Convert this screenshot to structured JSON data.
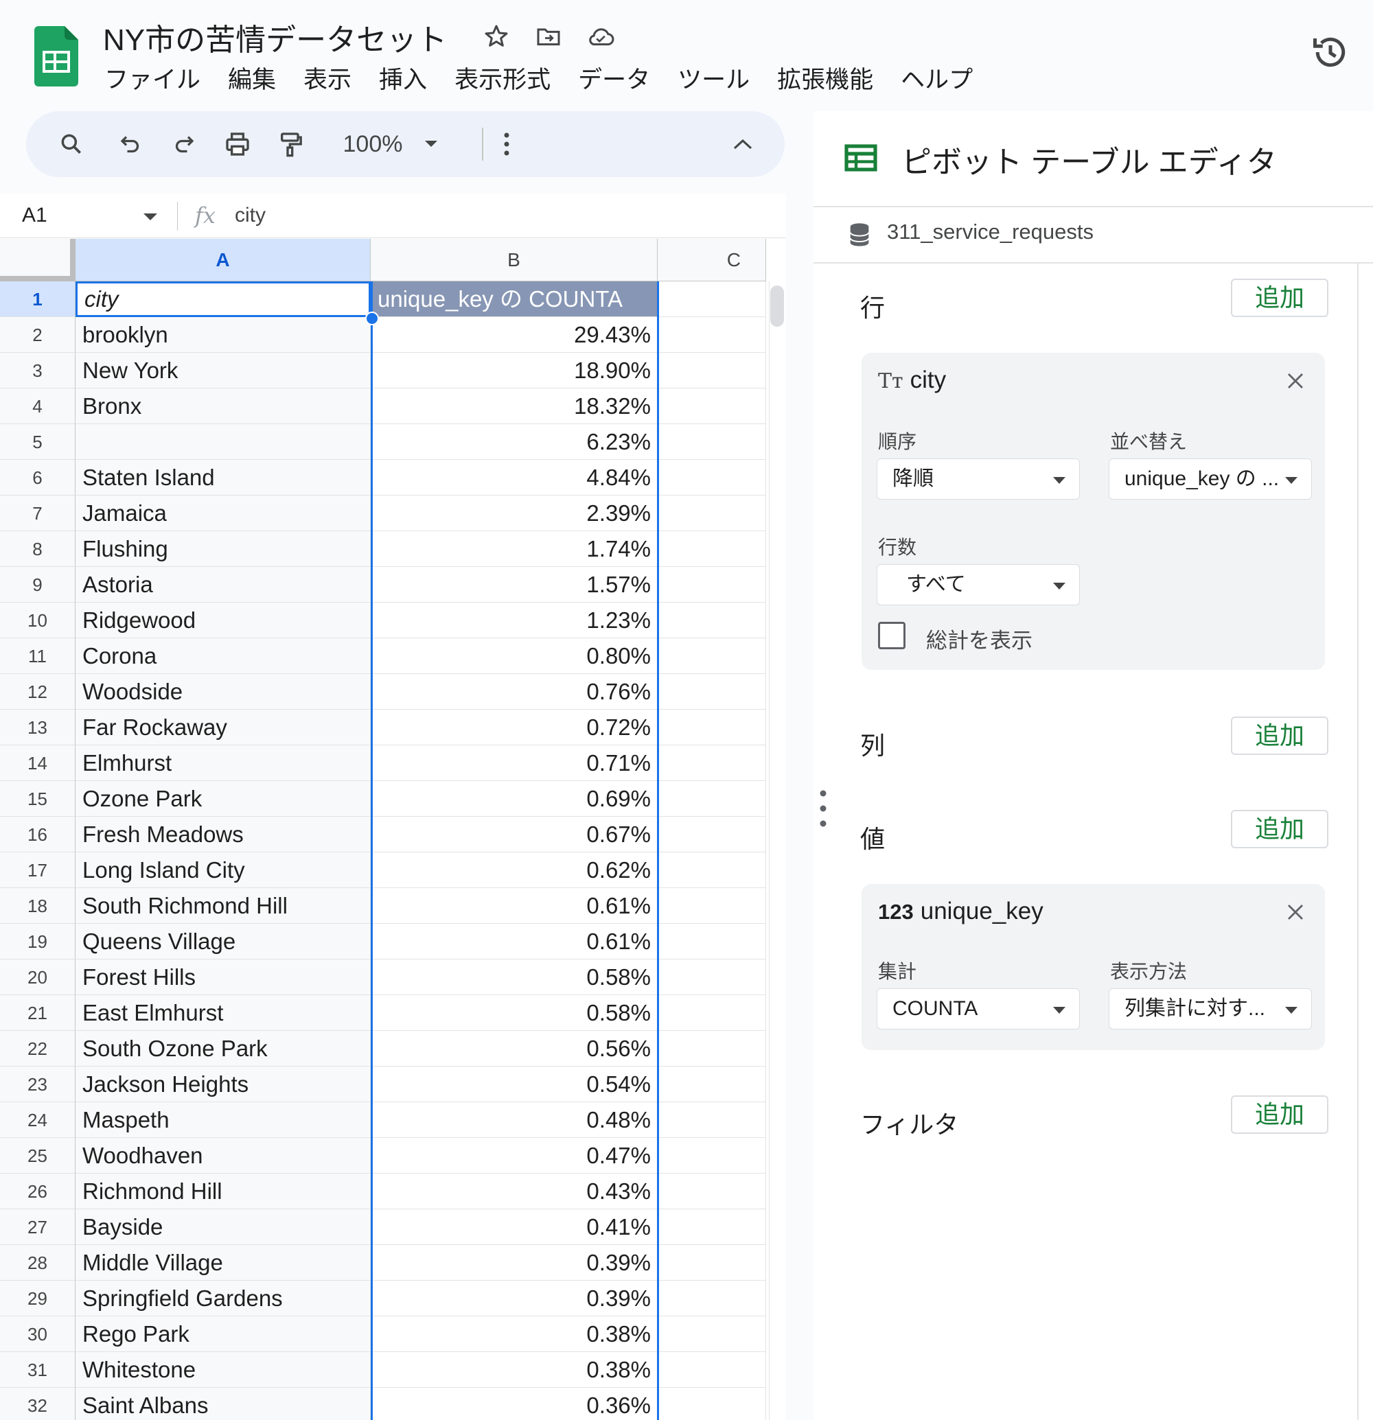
{
  "app": {
    "doc_title": "NY市の苦情データセット",
    "menu": [
      "ファイル",
      "編集",
      "表示",
      "挿入",
      "表示形式",
      "データ",
      "ツール",
      "拡張機能",
      "ヘルプ"
    ]
  },
  "toolbar": {
    "zoom": "100%"
  },
  "formula_bar": {
    "cell_ref": "A1",
    "fx": "fx",
    "value": "city"
  },
  "grid": {
    "columns": [
      "A",
      "B",
      "C"
    ],
    "header": {
      "row": "1",
      "a": "city",
      "b": "unique_key の COUNTA"
    },
    "rows": [
      {
        "n": "2",
        "city": "brooklyn",
        "pct": "29.43%"
      },
      {
        "n": "3",
        "city": "New York",
        "pct": "18.90%"
      },
      {
        "n": "4",
        "city": "Bronx",
        "pct": "18.32%"
      },
      {
        "n": "5",
        "city": "",
        "pct": "6.23%"
      },
      {
        "n": "6",
        "city": "Staten Island",
        "pct": "4.84%"
      },
      {
        "n": "7",
        "city": "Jamaica",
        "pct": "2.39%"
      },
      {
        "n": "8",
        "city": "Flushing",
        "pct": "1.74%"
      },
      {
        "n": "9",
        "city": "Astoria",
        "pct": "1.57%"
      },
      {
        "n": "10",
        "city": "Ridgewood",
        "pct": "1.23%"
      },
      {
        "n": "11",
        "city": "Corona",
        "pct": "0.80%"
      },
      {
        "n": "12",
        "city": "Woodside",
        "pct": "0.76%"
      },
      {
        "n": "13",
        "city": "Far Rockaway",
        "pct": "0.72%"
      },
      {
        "n": "14",
        "city": "Elmhurst",
        "pct": "0.71%"
      },
      {
        "n": "15",
        "city": "Ozone Park",
        "pct": "0.69%"
      },
      {
        "n": "16",
        "city": "Fresh Meadows",
        "pct": "0.67%"
      },
      {
        "n": "17",
        "city": "Long Island City",
        "pct": "0.62%"
      },
      {
        "n": "18",
        "city": "South Richmond Hill",
        "pct": "0.61%"
      },
      {
        "n": "19",
        "city": "Queens Village",
        "pct": "0.61%"
      },
      {
        "n": "20",
        "city": "Forest Hills",
        "pct": "0.58%"
      },
      {
        "n": "21",
        "city": "East Elmhurst",
        "pct": "0.58%"
      },
      {
        "n": "22",
        "city": "South Ozone Park",
        "pct": "0.56%"
      },
      {
        "n": "23",
        "city": "Jackson Heights",
        "pct": "0.54%"
      },
      {
        "n": "24",
        "city": "Maspeth",
        "pct": "0.48%"
      },
      {
        "n": "25",
        "city": "Woodhaven",
        "pct": "0.47%"
      },
      {
        "n": "26",
        "city": "Richmond Hill",
        "pct": "0.43%"
      },
      {
        "n": "27",
        "city": "Bayside",
        "pct": "0.41%"
      },
      {
        "n": "28",
        "city": "Middle Village",
        "pct": "0.39%"
      },
      {
        "n": "29",
        "city": "Springfield Gardens",
        "pct": "0.39%"
      },
      {
        "n": "30",
        "city": "Rego Park",
        "pct": "0.38%"
      },
      {
        "n": "31",
        "city": "Whitestone",
        "pct": "0.38%"
      },
      {
        "n": "32",
        "city": "Saint Albans",
        "pct": "0.36%"
      }
    ]
  },
  "pivot": {
    "title": "ピボット テーブル エディタ",
    "source": "311_service_requests",
    "add_label": "追加",
    "rows_label": "行",
    "cols_label": "列",
    "values_label": "値",
    "filters_label": "フィルタ",
    "row_card": {
      "icon": "Tт",
      "field": "city",
      "order_label": "順序",
      "order_value": "降順",
      "sort_label": "並べ替え",
      "sort_value": "unique_key の ...",
      "count_label": "行数",
      "count_value": "すべて",
      "totals_label": "総計を表示",
      "totals_checked": false
    },
    "value_card": {
      "icon": "123",
      "field": "unique_key",
      "agg_label": "集計",
      "agg_value": "COUNTA",
      "show_label": "表示方法",
      "show_value": "列集計に対す..."
    }
  },
  "colors": {
    "brand_green": "#188038",
    "selection_blue": "#1a73e8",
    "pivot_header_bg": "#8796b4"
  }
}
